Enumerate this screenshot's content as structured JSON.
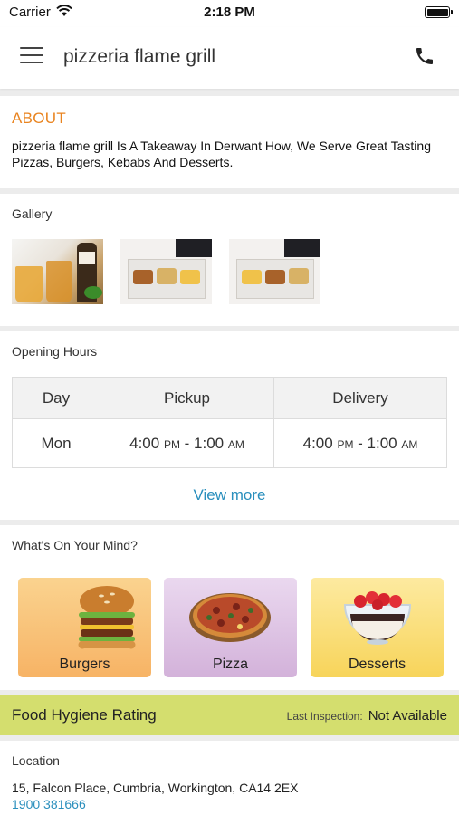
{
  "status_bar": {
    "carrier": "Carrier",
    "time": "2:18 PM"
  },
  "nav": {
    "title": "pizzeria flame grill",
    "menu_icon": "hamburger-menu-icon",
    "phone_icon": "phone-icon"
  },
  "about": {
    "heading": "ABOUT",
    "text": "pizzeria flame grill Is A Takeaway In Derwant How, We Serve Great Tasting Pizzas, Burgers, Kebabs And Desserts."
  },
  "gallery": {
    "label": "Gallery"
  },
  "hours": {
    "label": "Opening Hours",
    "headers": [
      "Day",
      "Pickup",
      "Delivery"
    ],
    "rows": [
      {
        "day": "Mon",
        "pickup_open": "4:00",
        "pickup_open_suffix": "PM",
        "pickup_close": "1:00",
        "pickup_close_suffix": "AM",
        "delivery_open": "4:00",
        "delivery_open_suffix": "PM",
        "delivery_close": "1:00",
        "delivery_close_suffix": "AM"
      }
    ],
    "view_more": "View more"
  },
  "mind": {
    "label": "What's On Your Mind?",
    "items": [
      {
        "label": "Burgers"
      },
      {
        "label": "Pizza"
      },
      {
        "label": "Desserts"
      }
    ]
  },
  "hygiene": {
    "title": "Food Hygiene Rating",
    "inspection_label": "Last Inspection:",
    "inspection_value": "Not Available"
  },
  "location": {
    "label": "Location",
    "address": "15, Falcon Place, Cumbria, Workington, CA14 2EX",
    "phone": "1900 381666"
  },
  "colors": {
    "accent_orange": "#e98420",
    "link_blue": "#2a8fbd",
    "hygiene_bg": "#d4de6e"
  }
}
